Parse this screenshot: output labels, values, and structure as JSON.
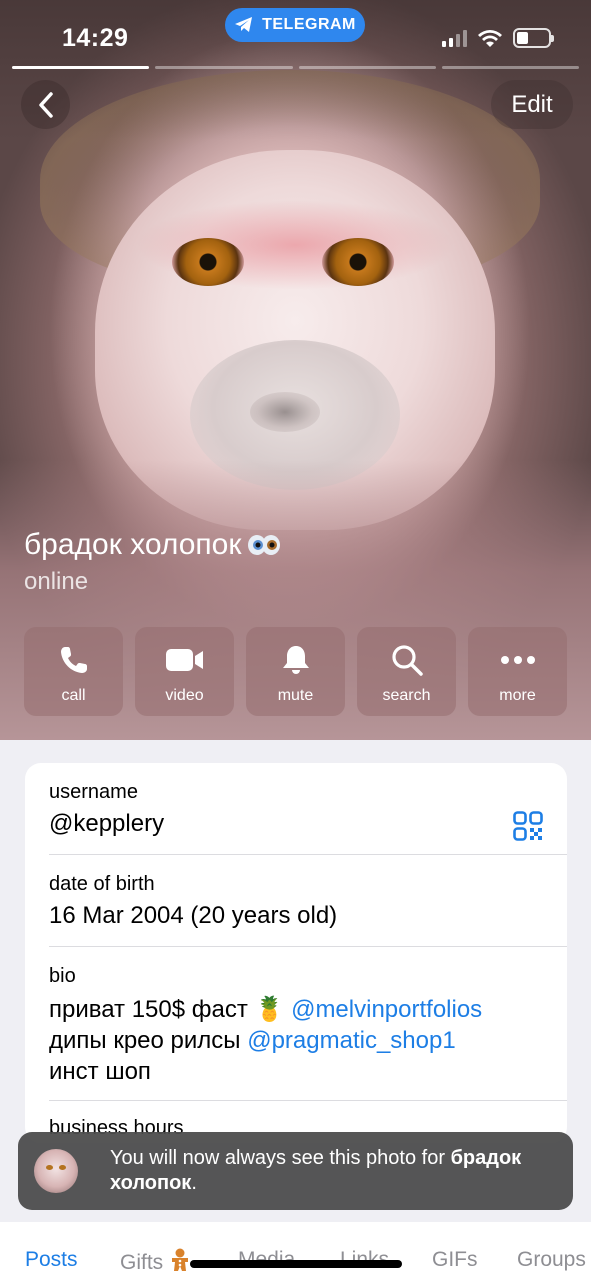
{
  "status_bar": {
    "time": "14:29",
    "app_pill": "TELEGRAM"
  },
  "header": {
    "back_icon": "chevron-left-icon",
    "edit_label": "Edit"
  },
  "profile": {
    "name": "брадок холопок",
    "emoji_badge": "eyes-emoji",
    "status": "online"
  },
  "actions": [
    {
      "label": "call",
      "icon": "phone-icon"
    },
    {
      "label": "video",
      "icon": "video-camera-icon"
    },
    {
      "label": "mute",
      "icon": "bell-icon"
    },
    {
      "label": "search",
      "icon": "search-icon"
    },
    {
      "label": "more",
      "icon": "more-dots-icon"
    }
  ],
  "info": {
    "username_label": "username",
    "username_value": "@kepplery",
    "dob_label": "date of birth",
    "dob_value": "16 Mar 2004 (20 years old)",
    "bio_label": "bio",
    "bio_line1_text": "приват 150$ фаст 🍍",
    "bio_line1_link": "@melvinportfolios",
    "bio_line2_text": "дипы крео рилсы",
    "bio_line2_link": "@pragmatic_shop1",
    "bio_line3_text": "инст шоп",
    "business_hours_label": "business hours"
  },
  "toast": {
    "text_before": "You will now always see this photo for",
    "name_bold": "брадок холопок",
    "text_after": "."
  },
  "tabs": [
    {
      "label": "Posts",
      "active": true
    },
    {
      "label": "Gifts",
      "active": false
    },
    {
      "label": "Media",
      "active": false
    },
    {
      "label": "Links",
      "active": false
    },
    {
      "label": "GIFs",
      "active": false
    },
    {
      "label": "Groups",
      "active": false
    }
  ],
  "colors": {
    "accent": "#1d7ee5",
    "telegram_pill": "#2f87ee",
    "toast_bg": "#4b4b4b"
  }
}
